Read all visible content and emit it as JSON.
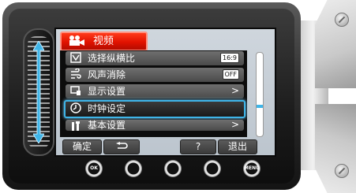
{
  "screen": {
    "title": "视频",
    "title_icon": "video-camera-icon",
    "menu": [
      {
        "label": "选择纵横比",
        "icon": "aspect-ratio-icon",
        "badge": "16:9"
      },
      {
        "label": "风声消除",
        "icon": "wind-icon",
        "badge": "OFF"
      },
      {
        "label": "显示设置",
        "icon": "display-icon",
        "arrow": ">"
      },
      {
        "label": "时钟设定",
        "icon": "clock-icon",
        "selected": true
      },
      {
        "label": "基本设置",
        "icon": "tools-icon",
        "arrow": ">"
      }
    ],
    "softkeys": {
      "ok": "确定",
      "back_icon": "return-arrow-icon",
      "help": "?",
      "exit": "退出"
    }
  },
  "hardware": {
    "buttons": [
      "OK",
      "",
      "",
      "",
      "MENU"
    ]
  },
  "colors": {
    "title_red": "#e11200",
    "highlight_blue": "#3fb5e8"
  }
}
